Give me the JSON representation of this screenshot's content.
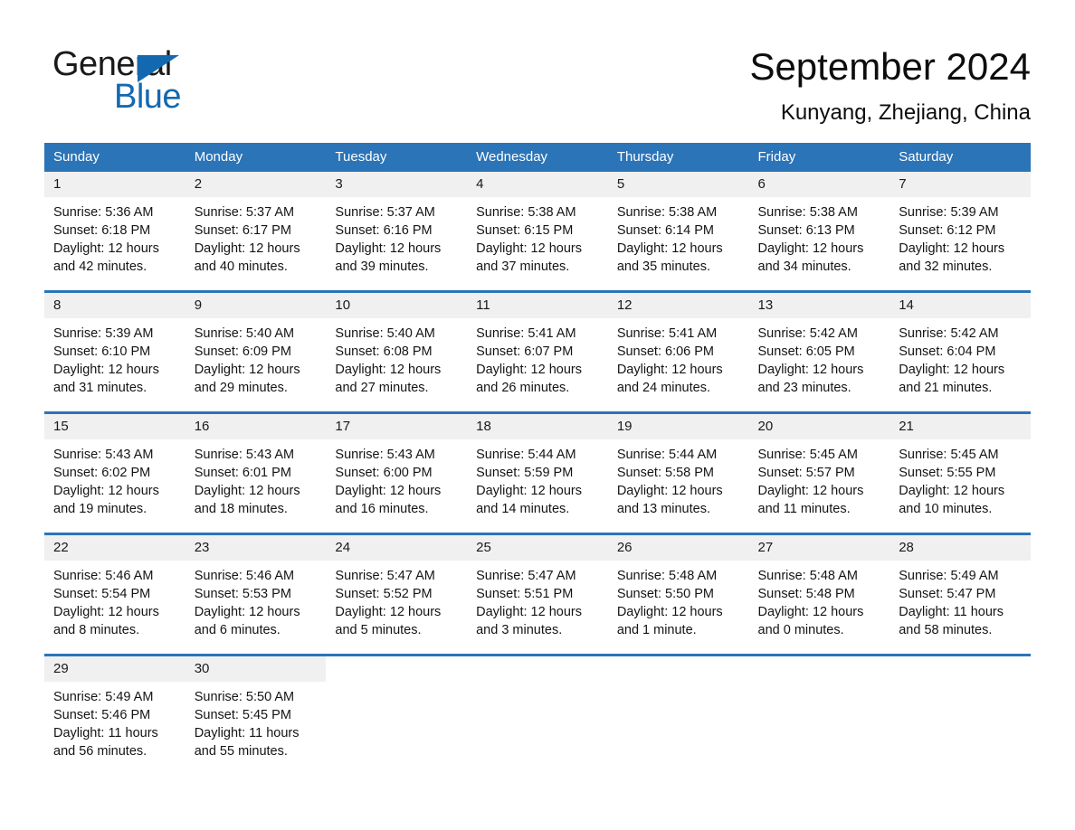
{
  "brand": {
    "name_part1": "General",
    "name_part2": "Blue",
    "logo_icon": "triangle-logo-icon",
    "accent_color": "#1369b0"
  },
  "header": {
    "month_title": "September 2024",
    "location": "Kunyang, Zhejiang, China"
  },
  "calendar": {
    "header_color": "#2b74b8",
    "daynum_band_color": "#f0f0f0",
    "weekdays": [
      "Sunday",
      "Monday",
      "Tuesday",
      "Wednesday",
      "Thursday",
      "Friday",
      "Saturday"
    ],
    "weeks": [
      [
        {
          "day": "1",
          "sunrise": "Sunrise: 5:36 AM",
          "sunset": "Sunset: 6:18 PM",
          "daylight": "Daylight: 12 hours and 42 minutes."
        },
        {
          "day": "2",
          "sunrise": "Sunrise: 5:37 AM",
          "sunset": "Sunset: 6:17 PM",
          "daylight": "Daylight: 12 hours and 40 minutes."
        },
        {
          "day": "3",
          "sunrise": "Sunrise: 5:37 AM",
          "sunset": "Sunset: 6:16 PM",
          "daylight": "Daylight: 12 hours and 39 minutes."
        },
        {
          "day": "4",
          "sunrise": "Sunrise: 5:38 AM",
          "sunset": "Sunset: 6:15 PM",
          "daylight": "Daylight: 12 hours and 37 minutes."
        },
        {
          "day": "5",
          "sunrise": "Sunrise: 5:38 AM",
          "sunset": "Sunset: 6:14 PM",
          "daylight": "Daylight: 12 hours and 35 minutes."
        },
        {
          "day": "6",
          "sunrise": "Sunrise: 5:38 AM",
          "sunset": "Sunset: 6:13 PM",
          "daylight": "Daylight: 12 hours and 34 minutes."
        },
        {
          "day": "7",
          "sunrise": "Sunrise: 5:39 AM",
          "sunset": "Sunset: 6:12 PM",
          "daylight": "Daylight: 12 hours and 32 minutes."
        }
      ],
      [
        {
          "day": "8",
          "sunrise": "Sunrise: 5:39 AM",
          "sunset": "Sunset: 6:10 PM",
          "daylight": "Daylight: 12 hours and 31 minutes."
        },
        {
          "day": "9",
          "sunrise": "Sunrise: 5:40 AM",
          "sunset": "Sunset: 6:09 PM",
          "daylight": "Daylight: 12 hours and 29 minutes."
        },
        {
          "day": "10",
          "sunrise": "Sunrise: 5:40 AM",
          "sunset": "Sunset: 6:08 PM",
          "daylight": "Daylight: 12 hours and 27 minutes."
        },
        {
          "day": "11",
          "sunrise": "Sunrise: 5:41 AM",
          "sunset": "Sunset: 6:07 PM",
          "daylight": "Daylight: 12 hours and 26 minutes."
        },
        {
          "day": "12",
          "sunrise": "Sunrise: 5:41 AM",
          "sunset": "Sunset: 6:06 PM",
          "daylight": "Daylight: 12 hours and 24 minutes."
        },
        {
          "day": "13",
          "sunrise": "Sunrise: 5:42 AM",
          "sunset": "Sunset: 6:05 PM",
          "daylight": "Daylight: 12 hours and 23 minutes."
        },
        {
          "day": "14",
          "sunrise": "Sunrise: 5:42 AM",
          "sunset": "Sunset: 6:04 PM",
          "daylight": "Daylight: 12 hours and 21 minutes."
        }
      ],
      [
        {
          "day": "15",
          "sunrise": "Sunrise: 5:43 AM",
          "sunset": "Sunset: 6:02 PM",
          "daylight": "Daylight: 12 hours and 19 minutes."
        },
        {
          "day": "16",
          "sunrise": "Sunrise: 5:43 AM",
          "sunset": "Sunset: 6:01 PM",
          "daylight": "Daylight: 12 hours and 18 minutes."
        },
        {
          "day": "17",
          "sunrise": "Sunrise: 5:43 AM",
          "sunset": "Sunset: 6:00 PM",
          "daylight": "Daylight: 12 hours and 16 minutes."
        },
        {
          "day": "18",
          "sunrise": "Sunrise: 5:44 AM",
          "sunset": "Sunset: 5:59 PM",
          "daylight": "Daylight: 12 hours and 14 minutes."
        },
        {
          "day": "19",
          "sunrise": "Sunrise: 5:44 AM",
          "sunset": "Sunset: 5:58 PM",
          "daylight": "Daylight: 12 hours and 13 minutes."
        },
        {
          "day": "20",
          "sunrise": "Sunrise: 5:45 AM",
          "sunset": "Sunset: 5:57 PM",
          "daylight": "Daylight: 12 hours and 11 minutes."
        },
        {
          "day": "21",
          "sunrise": "Sunrise: 5:45 AM",
          "sunset": "Sunset: 5:55 PM",
          "daylight": "Daylight: 12 hours and 10 minutes."
        }
      ],
      [
        {
          "day": "22",
          "sunrise": "Sunrise: 5:46 AM",
          "sunset": "Sunset: 5:54 PM",
          "daylight": "Daylight: 12 hours and 8 minutes."
        },
        {
          "day": "23",
          "sunrise": "Sunrise: 5:46 AM",
          "sunset": "Sunset: 5:53 PM",
          "daylight": "Daylight: 12 hours and 6 minutes."
        },
        {
          "day": "24",
          "sunrise": "Sunrise: 5:47 AM",
          "sunset": "Sunset: 5:52 PM",
          "daylight": "Daylight: 12 hours and 5 minutes."
        },
        {
          "day": "25",
          "sunrise": "Sunrise: 5:47 AM",
          "sunset": "Sunset: 5:51 PM",
          "daylight": "Daylight: 12 hours and 3 minutes."
        },
        {
          "day": "26",
          "sunrise": "Sunrise: 5:48 AM",
          "sunset": "Sunset: 5:50 PM",
          "daylight": "Daylight: 12 hours and 1 minute."
        },
        {
          "day": "27",
          "sunrise": "Sunrise: 5:48 AM",
          "sunset": "Sunset: 5:48 PM",
          "daylight": "Daylight: 12 hours and 0 minutes."
        },
        {
          "day": "28",
          "sunrise": "Sunrise: 5:49 AM",
          "sunset": "Sunset: 5:47 PM",
          "daylight": "Daylight: 11 hours and 58 minutes."
        }
      ],
      [
        {
          "day": "29",
          "sunrise": "Sunrise: 5:49 AM",
          "sunset": "Sunset: 5:46 PM",
          "daylight": "Daylight: 11 hours and 56 minutes."
        },
        {
          "day": "30",
          "sunrise": "Sunrise: 5:50 AM",
          "sunset": "Sunset: 5:45 PM",
          "daylight": "Daylight: 11 hours and 55 minutes."
        },
        {
          "day": "",
          "sunrise": "",
          "sunset": "",
          "daylight": ""
        },
        {
          "day": "",
          "sunrise": "",
          "sunset": "",
          "daylight": ""
        },
        {
          "day": "",
          "sunrise": "",
          "sunset": "",
          "daylight": ""
        },
        {
          "day": "",
          "sunrise": "",
          "sunset": "",
          "daylight": ""
        },
        {
          "day": "",
          "sunrise": "",
          "sunset": "",
          "daylight": ""
        }
      ]
    ]
  }
}
